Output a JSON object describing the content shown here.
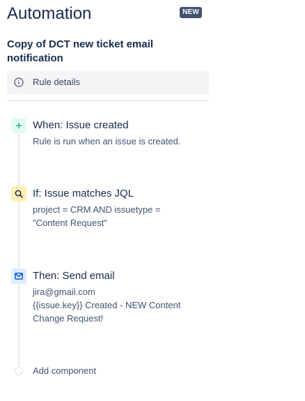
{
  "header": {
    "title": "Automation",
    "badge": "NEW"
  },
  "rule": {
    "name_line1": "Copy of DCT new ticket email",
    "name_line2": "notification",
    "details_label": "Rule details"
  },
  "steps": {
    "trigger": {
      "title": "When: Issue created",
      "desc": "Rule is run when an issue is created.",
      "icon": "plus-icon",
      "color": "#36b37e"
    },
    "condition": {
      "title": "If: Issue matches JQL",
      "desc_line1": "project = CRM AND issuetype =",
      "desc_line2": "\"Content Request\"",
      "icon": "search-icon",
      "color": "#ff991f"
    },
    "action": {
      "title": "Then: Send email",
      "desc_line1": "jira@gmail.com",
      "desc_line2": "{{issue.key}} Created - NEW Content",
      "desc_line3": "Change Request!",
      "icon": "mail-icon",
      "color": "#0052cc"
    }
  },
  "add_component": {
    "label": "Add component"
  }
}
